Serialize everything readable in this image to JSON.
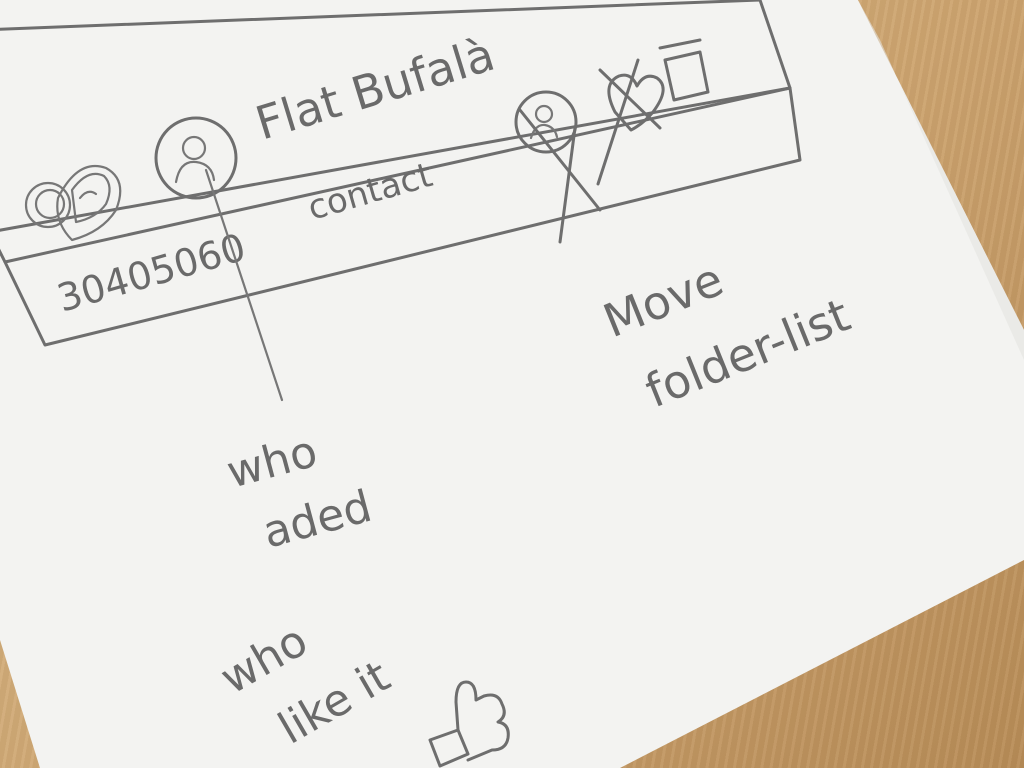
{
  "card": {
    "title": "Flat Bufalà",
    "phone": "30405060",
    "contact_label": "contact"
  },
  "annotations": {
    "who_added": [
      "who",
      "aded"
    ],
    "who_like_it": [
      "who",
      "like it"
    ],
    "move_folder_list": [
      "Move",
      "folder-list"
    ]
  },
  "icons": {
    "likes": "hearts-icon",
    "added_by": "user-avatar-icon",
    "collaborator": "user-avatar-icon-crossed",
    "favorite": "heart-icon-crossed",
    "folder": "folder-list-icon",
    "thumbs_up": "thumbs-up-icon"
  },
  "colors": {
    "pencil": "#6a6a6a",
    "paper": "#f4f4f2",
    "table": "#cda46f"
  }
}
